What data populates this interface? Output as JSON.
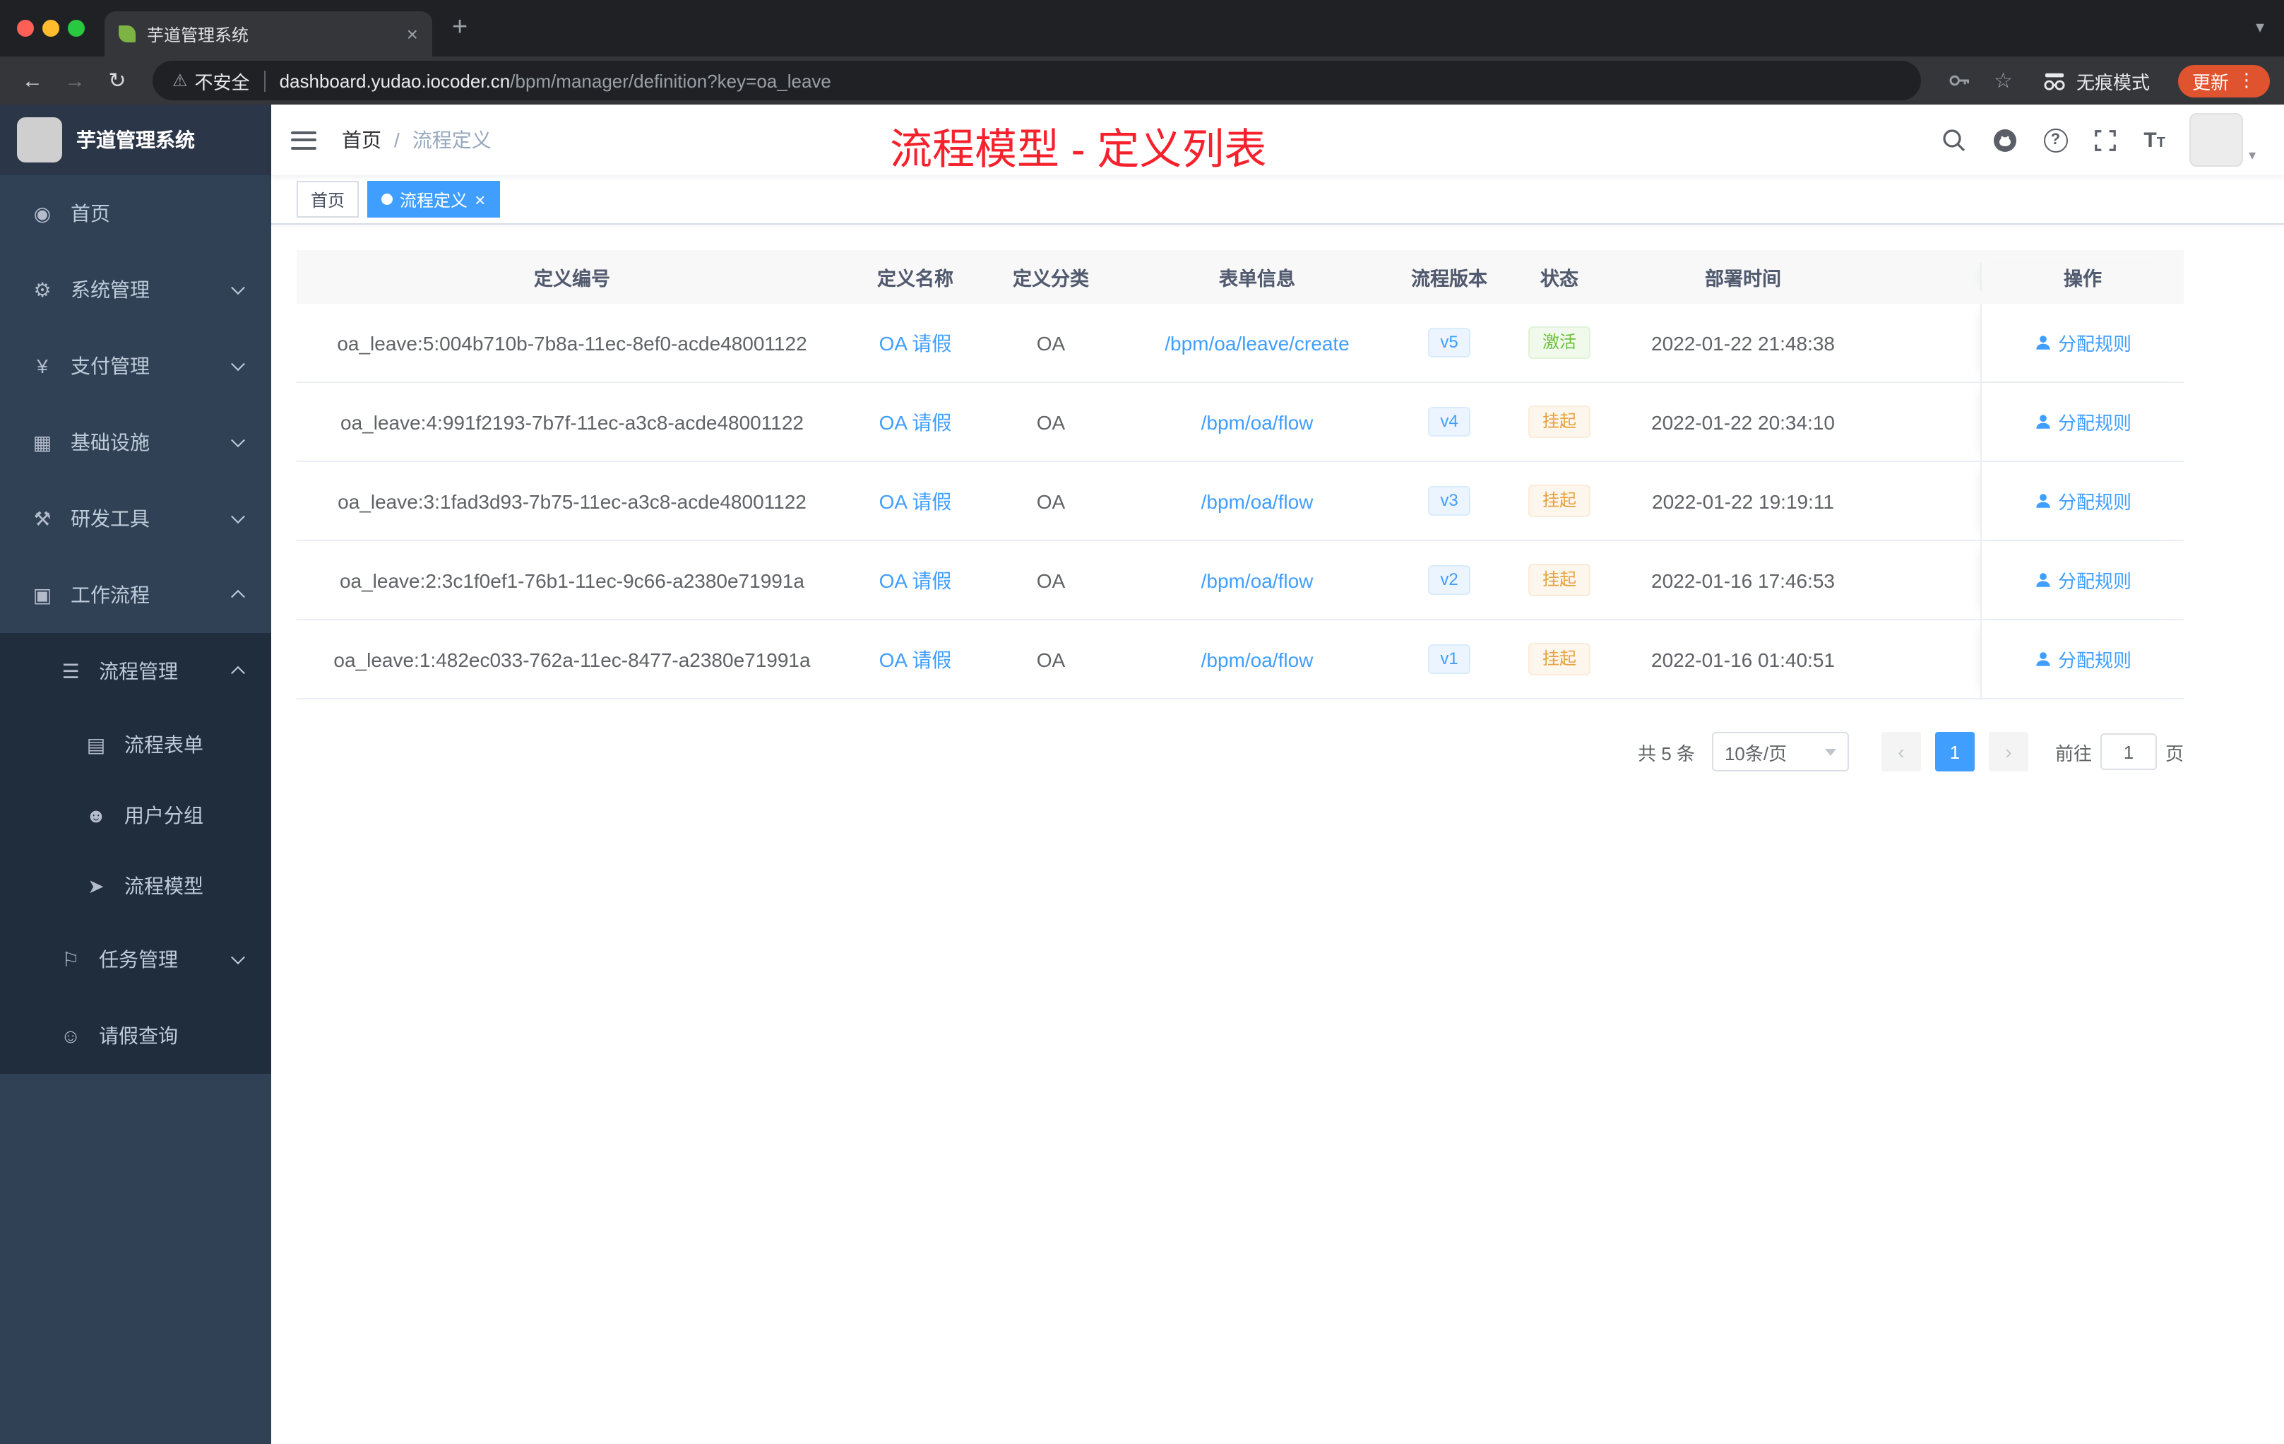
{
  "browser": {
    "tab_title": "芋道管理系统",
    "tab_close_glyph": "×",
    "new_tab_glyph": "+",
    "strip_chevron_glyph": "▾",
    "back_glyph": "←",
    "forward_glyph": "→",
    "reload_glyph": "↻",
    "warning_glyph": "⚠",
    "security_label": "不安全",
    "url_host": "dashboard.yudao.iocoder.cn",
    "url_path": "/bpm/manager/definition?key=oa_leave",
    "star_glyph": "☆",
    "incognito_label": "无痕模式",
    "update_label": "更新",
    "menu_dots_glyph": "⋮"
  },
  "sidebar": {
    "logo_title": "芋道管理系统",
    "items": [
      {
        "label": "首页",
        "icon": "dashboard-icon",
        "glyph": "◉"
      },
      {
        "label": "系统管理",
        "icon": "gear-icon",
        "glyph": "⚙"
      },
      {
        "label": "支付管理",
        "icon": "yen-icon",
        "glyph": "¥"
      },
      {
        "label": "基础设施",
        "icon": "infrastructure-icon",
        "glyph": "▦"
      },
      {
        "label": "研发工具",
        "icon": "tools-icon",
        "glyph": "⚒"
      },
      {
        "label": "工作流程",
        "icon": "workflow-icon",
        "glyph": "▣"
      },
      {
        "label": "流程管理",
        "icon": "process-list-icon",
        "glyph": "☰"
      },
      {
        "label": "流程表单",
        "icon": "form-icon",
        "glyph": "▤"
      },
      {
        "label": "用户分组",
        "icon": "user-group-icon",
        "glyph": "☻"
      },
      {
        "label": "流程模型",
        "icon": "paper-plane-icon",
        "glyph": "➤"
      },
      {
        "label": "任务管理",
        "icon": "task-flag-icon",
        "glyph": "⚐"
      },
      {
        "label": "请假查询",
        "icon": "user-icon",
        "glyph": "☺"
      }
    ]
  },
  "navbar": {
    "breadcrumb_home": "首页",
    "breadcrumb_sep": "/",
    "breadcrumb_current": "流程定义",
    "annotation": "流程模型 - 定义列表",
    "avatar_caret_glyph": "▾",
    "font_size_icon_text": "T"
  },
  "tags": {
    "first": "首页",
    "active": "流程定义",
    "close_glyph": "×"
  },
  "table": {
    "columns": [
      "定义编号",
      "定义名称",
      "定义分类",
      "表单信息",
      "流程版本",
      "状态",
      "部署时间",
      "操作"
    ],
    "action_label": "分配规则",
    "rows": [
      {
        "id": "oa_leave:5:004b710b-7b8a-11ec-8ef0-acde48001122",
        "name": "OA 请假",
        "category": "OA",
        "form": "/bpm/oa/leave/create",
        "version": "v5",
        "status": "激活",
        "time": "2022-01-22 21:48:38"
      },
      {
        "id": "oa_leave:4:991f2193-7b7f-11ec-a3c8-acde48001122",
        "name": "OA 请假",
        "category": "OA",
        "form": "/bpm/oa/flow",
        "version": "v4",
        "status": "挂起",
        "time": "2022-01-22 20:34:10"
      },
      {
        "id": "oa_leave:3:1fad3d93-7b75-11ec-a3c8-acde48001122",
        "name": "OA 请假",
        "category": "OA",
        "form": "/bpm/oa/flow",
        "version": "v3",
        "status": "挂起",
        "time": "2022-01-22 19:19:11"
      },
      {
        "id": "oa_leave:2:3c1f0ef1-76b1-11ec-9c66-a2380e71991a",
        "name": "OA 请假",
        "category": "OA",
        "form": "/bpm/oa/flow",
        "version": "v2",
        "status": "挂起",
        "time": "2022-01-16 17:46:53"
      },
      {
        "id": "oa_leave:1:482ec033-762a-11ec-8477-a2380e71991a",
        "name": "OA 请假",
        "category": "OA",
        "form": "/bpm/oa/flow",
        "version": "v1",
        "status": "挂起",
        "time": "2022-01-16 01:40:51"
      }
    ]
  },
  "pagination": {
    "total": "共 5 条",
    "page_size": "10条/页",
    "prev_glyph": "‹",
    "page": "1",
    "next_glyph": "›",
    "goto_label": "前往",
    "goto_value": "1",
    "unit": "页"
  },
  "colors": {
    "accent": "#409eff",
    "success": "#67c23a",
    "warning": "#e6a23c",
    "annotation_red": "#f5222d",
    "sidebar_bg": "#304156",
    "sidebar_submenu_bg": "#1f2d3d",
    "chrome_bg": "#202124",
    "toolbar_bg": "#35363a",
    "update_badge": "#e0532f",
    "active_tag_bg": "#409eff"
  }
}
